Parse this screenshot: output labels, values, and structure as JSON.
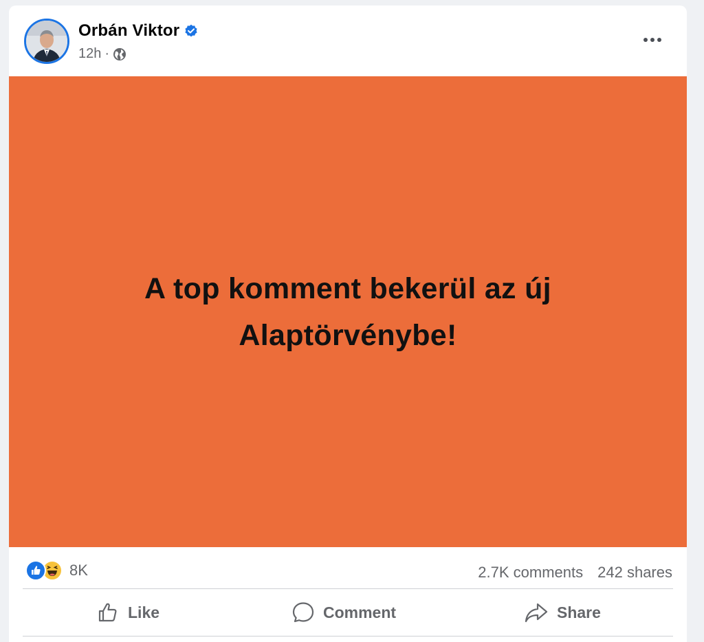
{
  "post": {
    "author": "Orbán Viktor",
    "time": "12h",
    "separator": "·",
    "icons": {
      "verified": "verified-badge-icon",
      "privacy": "globe-icon",
      "more": "more-options-icon"
    },
    "text": "A top komment bekerül az új Alaptörvénybe!",
    "background_color": "#ec6d3a"
  },
  "stats": {
    "reaction_icons": [
      "like-reaction-icon",
      "haha-reaction-icon"
    ],
    "reaction_count": "8K",
    "comments": "2.7K comments",
    "shares": "242 shares"
  },
  "actions": {
    "like": "Like",
    "comment": "Comment",
    "share": "Share"
  }
}
